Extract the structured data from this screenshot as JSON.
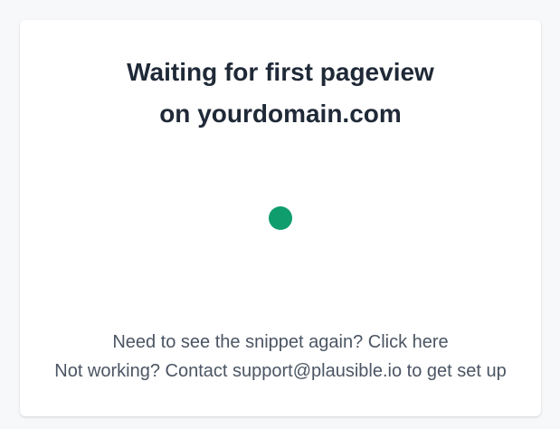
{
  "waiting": {
    "title_line1": "Waiting for first pageview",
    "title_line2": "on yourdomain.com",
    "indicator_color": "#0f9d6e"
  },
  "help": {
    "snippet_prefix": "Need to see the snippet again? ",
    "snippet_link": "Click here",
    "contact_prefix": "Not working? Contact ",
    "contact_email": "support@plausible.io",
    "contact_suffix": " to get set up"
  }
}
